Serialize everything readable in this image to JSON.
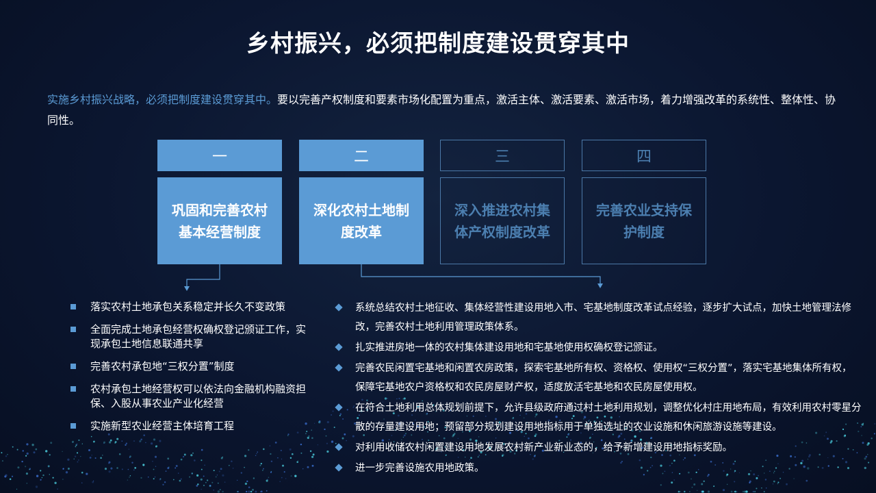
{
  "title": "乡村振兴，必须把制度建设贯穿其中",
  "intro": {
    "highlight": "实施乡村振兴战略，必须把制度建设贯穿其中。",
    "rest": "要以完善产权制度和要素市场化配置为重点，激活主体、激活要素、激活市场，着力增强改革的系统性、整体性、协同性。"
  },
  "colors": {
    "accent": "#5b9bd5",
    "inactive_border": "#4c79a8",
    "background": "#0b1630"
  },
  "tabs": [
    {
      "number": "一",
      "label": "巩固和完善农村基本经营制度",
      "active": true
    },
    {
      "number": "二",
      "label": "深化农村土地制度改革",
      "active": true
    },
    {
      "number": "三",
      "label": "深入推进农村集体产权制度改革",
      "active": false
    },
    {
      "number": "四",
      "label": "完善农业支持保护制度",
      "active": false
    }
  ],
  "left_list": [
    "落实农村土地承包关系稳定并长久不变政策",
    "全面完成土地承包经营权确权登记颁证工作，实现承包土地信息联通共享",
    "完善农村承包地“三权分置”制度",
    "农村承包土地经营权可以依法向金融机构融资担保、入股从事农业产业化经营",
    "实施新型农业经营主体培育工程"
  ],
  "right_list": [
    "系统总结农村土地征收、集体经营性建设用地入市、宅基地制度改革试点经验，逐步扩大试点，加快土地管理法修改，完善农村土地利用管理政策体系。",
    "扎实推进房地一体的农村集体建设用地和宅基地使用权确权登记颁证。",
    "完善农民闲置宅基地和闲置农房政策，探索宅基地所有权、资格权、使用权“三权分置”，落实宅基地集体所有权，保障宅基地农户资格权和农民房屋财产权，适度放活宅基地和农民房屋使用权。",
    "在符合土地利用总体规划前提下，允许县级政府通过村土地利用规划，调整优化村庄用地布局，有效利用农村零星分散的存量建设用地；预留部分规划建设用地指标用于单独选址的农业设施和休闲旅游设施等建设。",
    "对利用收储农村闲置建设用地发展农村新产业新业态的，给予新增建设用地指标奖励。",
    "进一步完善设施农用地政策。"
  ]
}
